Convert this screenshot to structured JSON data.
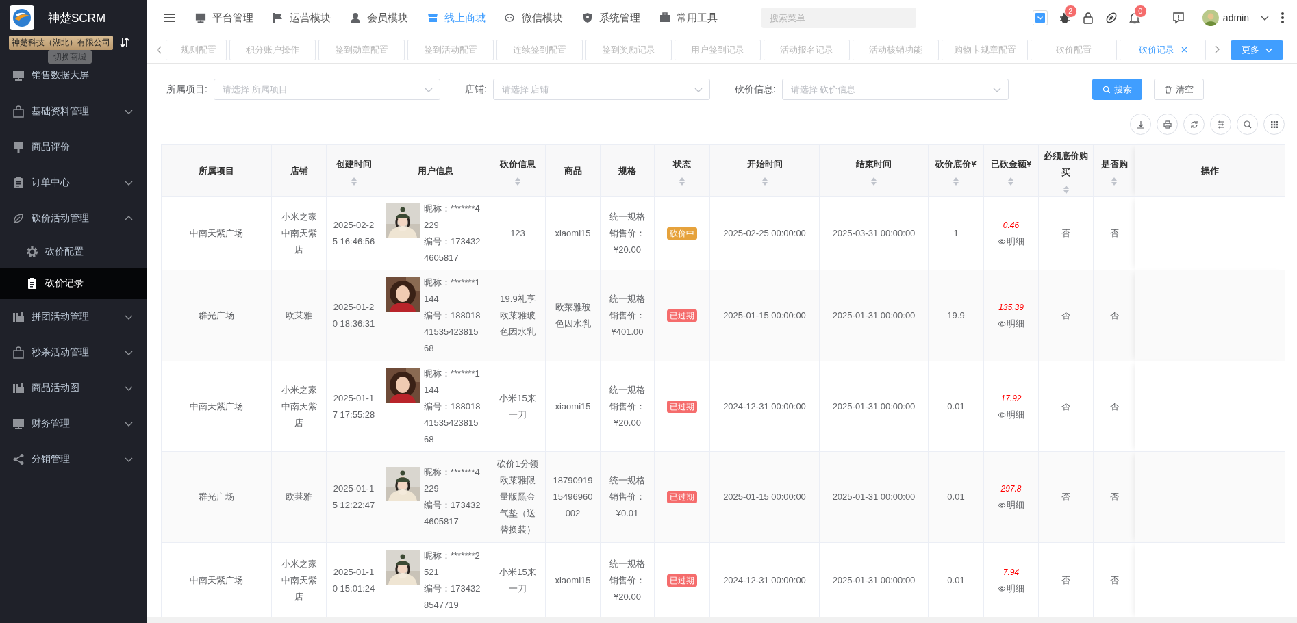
{
  "sidebar": {
    "brand": "神楚SCRM",
    "company": "神楚科技（湖北）有限公司",
    "tooltip": "切换商城",
    "items": [
      {
        "label": "销售数据大屏",
        "kind": "link",
        "selected": false
      },
      {
        "label": "基础资料管理",
        "kind": "group",
        "expanded": false,
        "selected": false
      },
      {
        "label": "商品评价",
        "kind": "link",
        "selected": false
      },
      {
        "label": "订单中心",
        "kind": "group",
        "expanded": false,
        "selected": false
      },
      {
        "label": "砍价活动管理",
        "kind": "group",
        "expanded": true,
        "selected": false,
        "children": [
          {
            "label": "砍价配置",
            "selected": false
          },
          {
            "label": "砍价记录",
            "selected": true
          }
        ]
      },
      {
        "label": "拼团活动管理",
        "kind": "group",
        "expanded": false,
        "selected": false
      },
      {
        "label": "秒杀活动管理",
        "kind": "group",
        "expanded": false,
        "selected": false
      },
      {
        "label": "商品活动图",
        "kind": "group",
        "expanded": false,
        "selected": false
      },
      {
        "label": "财务管理",
        "kind": "group",
        "expanded": false,
        "selected": false
      },
      {
        "label": "分销管理",
        "kind": "group",
        "expanded": false,
        "selected": false
      }
    ]
  },
  "top_nav": {
    "items": [
      {
        "label": "平台管理",
        "selected": false
      },
      {
        "label": "运营模块",
        "selected": false
      },
      {
        "label": "会员模块",
        "selected": false
      },
      {
        "label": "线上商城",
        "selected": true
      },
      {
        "label": "微信模块",
        "selected": false
      },
      {
        "label": "系统管理",
        "selected": false
      },
      {
        "label": "常用工具",
        "selected": false
      }
    ],
    "search": {
      "placeholder": "搜索菜单"
    },
    "bug_count": "2",
    "bell_count": "0",
    "user": "admin"
  },
  "tabs": {
    "items": [
      {
        "label": "规则配置",
        "selected": false
      },
      {
        "label": "积分账户操作",
        "selected": false
      },
      {
        "label": "签到勋章配置",
        "selected": false
      },
      {
        "label": "签到活动配置",
        "selected": false
      },
      {
        "label": "连续签到配置",
        "selected": false
      },
      {
        "label": "签到奖励记录",
        "selected": false
      },
      {
        "label": "用户签到记录",
        "selected": false
      },
      {
        "label": "活动报名记录",
        "selected": false
      },
      {
        "label": "活动核销功能",
        "selected": false
      },
      {
        "label": "购物卡规章配置",
        "selected": false
      },
      {
        "label": "砍价配置",
        "selected": false
      },
      {
        "label": "砍价记录",
        "selected": true
      }
    ],
    "more": "更多"
  },
  "filter": {
    "fields": [
      {
        "label": "所属项目:",
        "placeholder": "请选择 所属项目"
      },
      {
        "label": "店铺:",
        "placeholder": "请选择 店铺"
      },
      {
        "label": "砍价信息:",
        "placeholder": "请选择 砍价信息"
      }
    ],
    "search_button": "搜索",
    "clear_button": "清空"
  },
  "table": {
    "columns": [
      {
        "label": "所属项目",
        "sortable": false
      },
      {
        "label": "店铺",
        "sortable": false
      },
      {
        "label": "创建时间",
        "sortable": true
      },
      {
        "label": "用户信息",
        "sortable": false
      },
      {
        "label": "砍价信息",
        "sortable": true
      },
      {
        "label": "商品",
        "sortable": false
      },
      {
        "label": "规格",
        "sortable": false
      },
      {
        "label": "状态",
        "sortable": true
      },
      {
        "label": "开始时间",
        "sortable": true
      },
      {
        "label": "结束时间",
        "sortable": true
      },
      {
        "label": "砍价底价¥",
        "sortable": true
      },
      {
        "label": "已砍金额¥",
        "sortable": true
      },
      {
        "label": "必须底价购买",
        "sortable": true
      },
      {
        "label": "是否购",
        "sortable": true
      },
      {
        "label": "操作",
        "sortable": false
      }
    ],
    "rows": [
      {
        "project": "中南天紫广场",
        "store": "小米之家中南天紫店",
        "created": "2025-02-25 16:46:56",
        "nickname": "昵称：*******4229",
        "user_id": "编号：1734324605817",
        "bargain": "123",
        "product": "xiaomi15",
        "spec": "统一规格",
        "price": "销售价：¥20.00",
        "status": {
          "text": "砍价中",
          "color": "#e6a23c"
        },
        "start": "2025-02-25 00:00:00",
        "end": "2025-03-31 00:00:00",
        "floor_price": "1",
        "cut_amount": "0.46",
        "detail": "明细",
        "must_floor": "否",
        "purchased": "否"
      },
      {
        "project": "群光广场",
        "store": "欧莱雅",
        "created": "2025-01-20 18:36:31",
        "nickname": "昵称：*******1144",
        "user_id": "编号：1880184153542381568",
        "bargain": "19.9礼享欧莱雅玻色因水乳",
        "product": "欧莱雅玻色因水乳",
        "spec": "统一规格",
        "price": "销售价：¥401.00",
        "status": {
          "text": "已过期",
          "color": "#f56c6c"
        },
        "start": "2025-01-15 00:00:00",
        "end": "2025-01-31 00:00:00",
        "floor_price": "19.9",
        "cut_amount": "135.39",
        "detail": "明细",
        "must_floor": "否",
        "purchased": "否"
      },
      {
        "project": "中南天紫广场",
        "store": "小米之家中南天紫店",
        "created": "2025-01-17 17:55:28",
        "nickname": "昵称：*******1144",
        "user_id": "编号：1880184153542381568",
        "bargain": "小米15来一刀",
        "product": "xiaomi15",
        "spec": "统一规格",
        "price": "销售价：¥20.00",
        "status": {
          "text": "已过期",
          "color": "#f56c6c"
        },
        "start": "2024-12-31 00:00:00",
        "end": "2025-01-31 00:00:00",
        "floor_price": "0.01",
        "cut_amount": "17.92",
        "detail": "明细",
        "must_floor": "否",
        "purchased": "否"
      },
      {
        "project": "群光广场",
        "store": "欧莱雅",
        "created": "2025-01-15 12:22:47",
        "nickname": "昵称：*******4229",
        "user_id": "编号：1734324605817",
        "bargain": "砍价1分领欧莱雅限量版黑金气垫（送替换装）",
        "product": "1879091915496960002",
        "spec": "统一规格",
        "price": "销售价：¥0.01",
        "status": {
          "text": "已过期",
          "color": "#f56c6c"
        },
        "start": "2025-01-15 00:00:00",
        "end": "2025-01-31 00:00:00",
        "floor_price": "0.01",
        "cut_amount": "297.8",
        "detail": "明细",
        "must_floor": "否",
        "purchased": "否"
      },
      {
        "project": "中南天紫广场",
        "store": "小米之家中南天紫店",
        "created": "2025-01-10 15:01:24",
        "nickname": "昵称：*******2521",
        "user_id": "编号：1734328547719",
        "bargain": "小米15来一刀",
        "product": "xiaomi15",
        "spec": "统一规格",
        "price": "销售价：¥20.00",
        "status": {
          "text": "已过期",
          "color": "#f56c6c"
        },
        "start": "2024-12-31 00:00:00",
        "end": "2025-01-31 00:00:00",
        "floor_price": "0.01",
        "cut_amount": "7.94",
        "detail": "明细",
        "must_floor": "否",
        "purchased": "否"
      }
    ]
  }
}
